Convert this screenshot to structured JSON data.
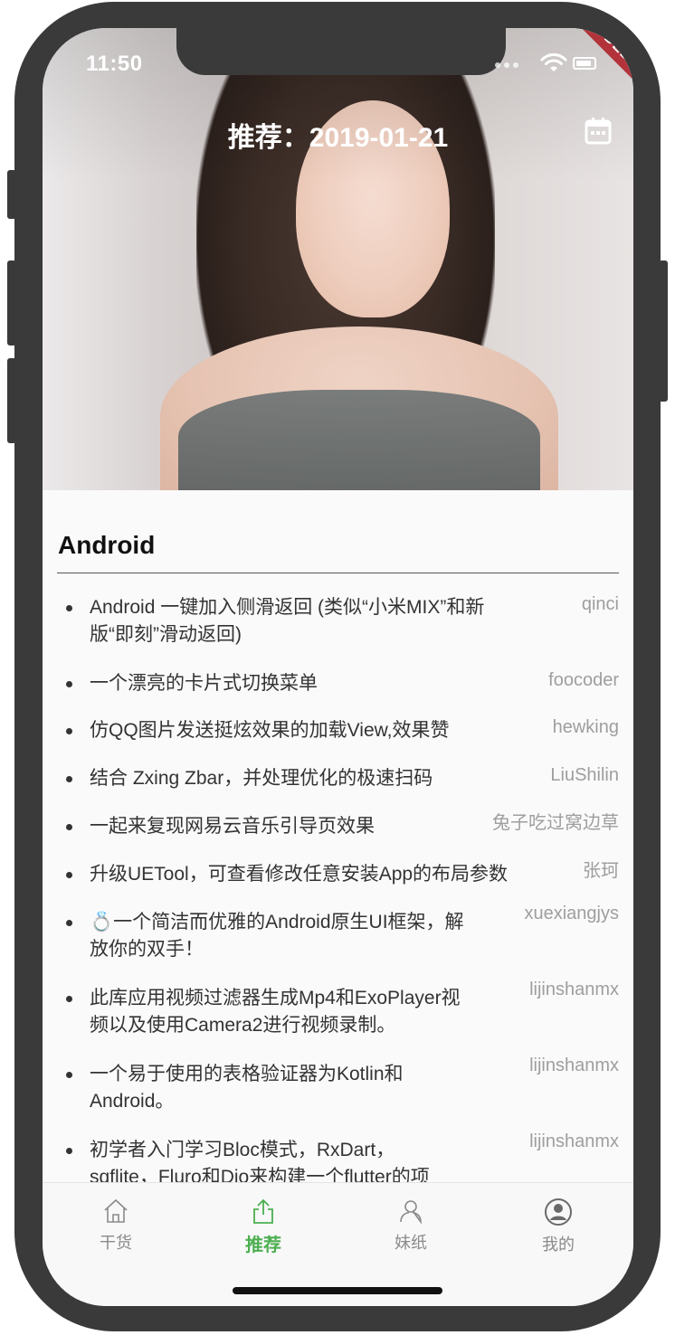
{
  "status_bar": {
    "time": "11:50"
  },
  "debug_badge": "DEBUG",
  "header": {
    "title": "推荐：2019-01-21",
    "calendar_icon": "calendar-icon"
  },
  "section": {
    "title": "Android"
  },
  "items": [
    {
      "title_line1": "Android 一键加入侧滑返回 (类似“小米MIX”和新",
      "title_line2": "版“即刻”滑动返回)",
      "author": "qinci"
    },
    {
      "title_line1": "一个漂亮的卡片式切换菜单",
      "title_line2": "",
      "author": "foocoder"
    },
    {
      "title_line1": "仿QQ图片发送挺炫效果的加载View,效果赞",
      "title_line2": "",
      "author": "hewking"
    },
    {
      "title_line1": "结合 Zxing Zbar，并处理优化的极速扫码",
      "title_line2": "",
      "author": "LiuShilin"
    },
    {
      "title_line1": "一起来复现网易云音乐引导页效果",
      "title_line2": "",
      "author": "兔子吃过窝边草"
    },
    {
      "title_line1": "升级UETool，可查看修改任意安装App的布局参数",
      "title_line2": "",
      "author": "张珂"
    },
    {
      "title_line1": "💍一个简洁而优雅的Android原生UI框架，解",
      "title_line2": "放你的双手！",
      "author": "xuexiangjys"
    },
    {
      "title_line1": "此库应用视频过滤器生成Mp4和ExoPlayer视",
      "title_line2": "频以及使用Camera2进行视频录制。",
      "author": "lijinshanmx"
    },
    {
      "title_line1": "一个易于使用的表格验证器为Kotlin和",
      "title_line2": "Android。",
      "author": "lijinshanmx"
    },
    {
      "title_line1": "初学者入门学习Bloc模式，RxDart，",
      "title_line2": "sqflite，Fluro和Dio来构建一个flutter的项",
      "author": "lijinshanmx"
    }
  ],
  "tabs": [
    {
      "label": "干货",
      "icon": "home-icon",
      "active": false
    },
    {
      "label": "推荐",
      "icon": "share-icon",
      "active": true
    },
    {
      "label": "妹纸",
      "icon": "person-outline-icon",
      "active": false
    },
    {
      "label": "我的",
      "icon": "account-circle-icon",
      "active": false
    }
  ],
  "colors": {
    "accent": "#4caf50",
    "tab_inactive": "#8a8a8a",
    "author": "#9e9e9e",
    "debug": "#b3333b"
  }
}
